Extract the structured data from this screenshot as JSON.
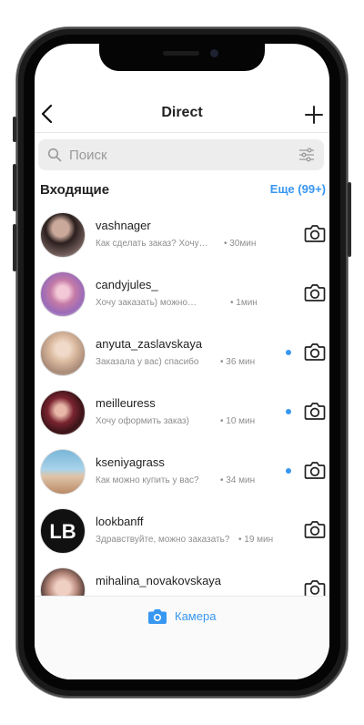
{
  "header": {
    "back_icon": "chevron-left-icon",
    "title": "Direct",
    "plus_icon": "plus-icon"
  },
  "search": {
    "placeholder": "Поиск",
    "search_icon": "search-icon",
    "filter_icon": "filter-icon"
  },
  "inbox": {
    "title": "Входящие",
    "more": "Еще (99+)"
  },
  "threads": [
    {
      "username": "vashnager",
      "preview": "Как сделать заказ? Хочу…",
      "time": "• 30мин",
      "unread": false
    },
    {
      "username": "candyjules_",
      "preview": "Хочу заказать) можно…",
      "time": "• 1мин",
      "unread": false
    },
    {
      "username": "anyuta_zaslavskaya",
      "preview": "Заказала у вас) спасибо",
      "time": "• 36 мин",
      "unread": true
    },
    {
      "username": "meilleuress",
      "preview": "Хочу оформить заказ)",
      "time": "• 10 мин",
      "unread": true
    },
    {
      "username": "kseniyagrass",
      "preview": "Как можно купить у вас?",
      "time": "• 34 мин",
      "unread": true
    },
    {
      "username": "lookbanff",
      "preview": "Здравствуйте, можно заказать?",
      "time": "• 19 мин",
      "unread": false
    },
    {
      "username": "mihalina_novakovskaya",
      "preview": "",
      "time": "",
      "unread": false
    }
  ],
  "footer": {
    "camera_label": "Камера",
    "camera_icon": "camera-icon"
  },
  "colors": {
    "accent": "#3897f0",
    "text": "#222222",
    "muted": "#8e8e8e"
  }
}
